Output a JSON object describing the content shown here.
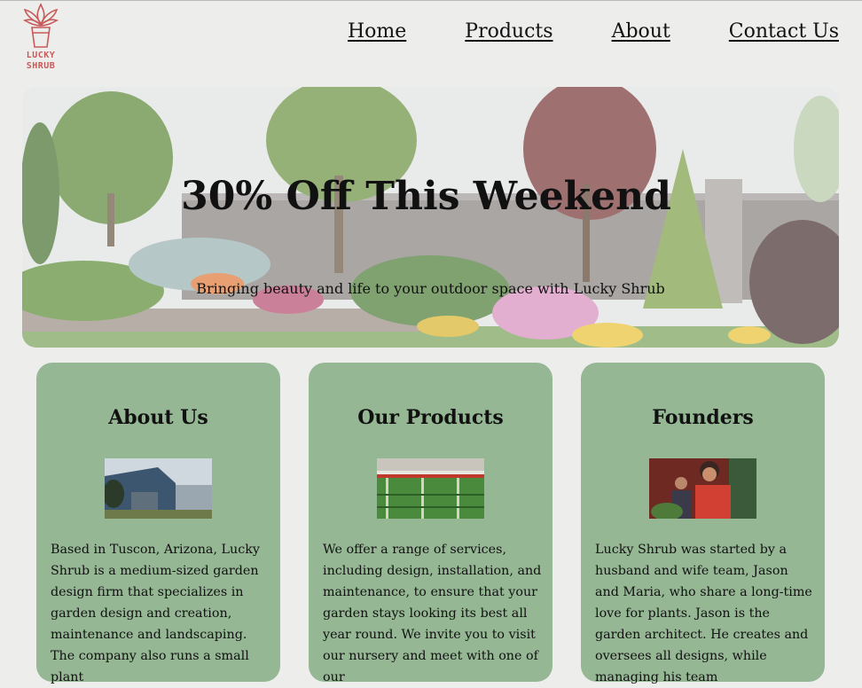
{
  "brand": {
    "logo_text_line1": "LUCKY",
    "logo_text_line2": "SHRUB",
    "logo_color": "#c85a5a"
  },
  "nav": {
    "items": [
      "Home",
      "Products",
      "About",
      "Contact Us"
    ]
  },
  "hero": {
    "title": "30% Off This Weekend",
    "subtitle": "Bringing beauty and life to your outdoor space with Lucky Shrub"
  },
  "cards": [
    {
      "title": "About Us",
      "image_icon": "storefront-photo",
      "text": "Based in Tuscon, Arizona, Lucky Shrub is a medium-sized garden design firm that specializes in garden design and creation, maintenance and landscaping. The company also runs a small plant"
    },
    {
      "title": "Our Products",
      "image_icon": "greenhouse-photo",
      "text": "We offer a range of services, including design, installation, and maintenance, to ensure that your garden stays looking its best all year round. We invite you to visit our nursery and meet with one of our"
    },
    {
      "title": "Founders",
      "image_icon": "founders-photo",
      "text": "Lucky Shrub was started by a husband and wife team, Jason and Maria, who share a long-time love for plants. Jason is the garden architect. He creates and oversees all designs, while managing his team"
    }
  ],
  "colors": {
    "card_bg": "#95b794",
    "page_bg": "#edeeec"
  }
}
